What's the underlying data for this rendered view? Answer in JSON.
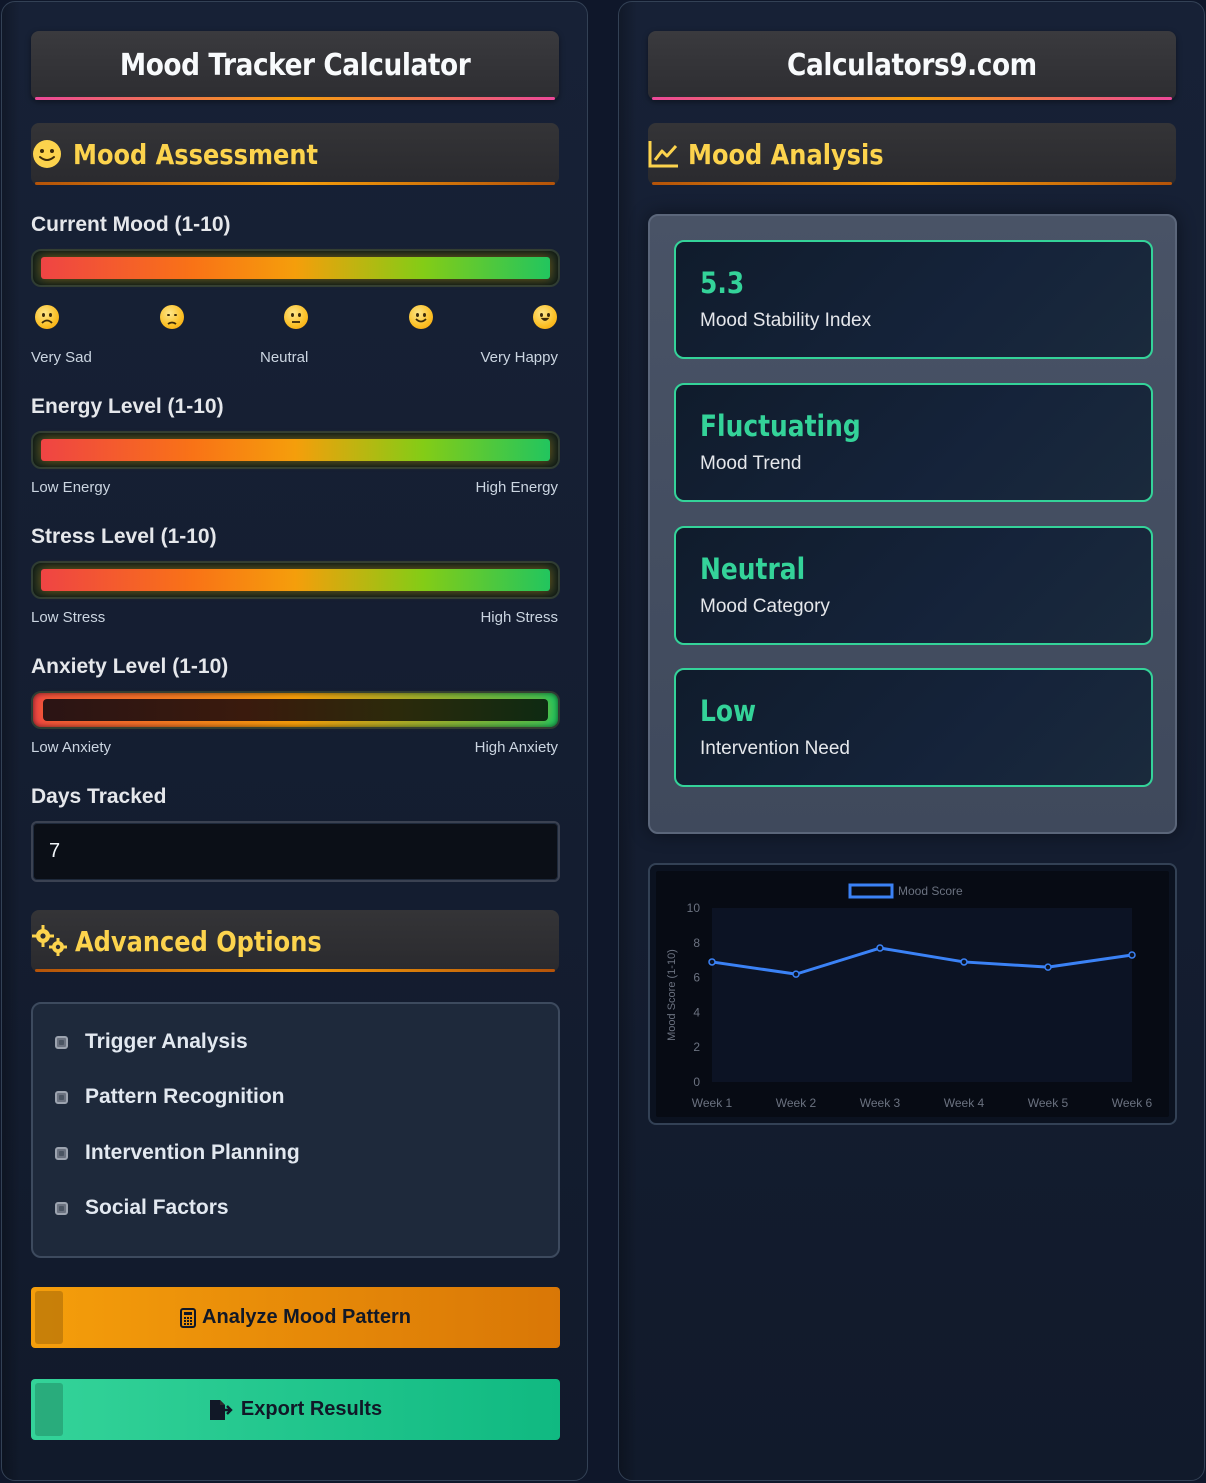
{
  "left_panel": {
    "title": "Mood Tracker Calculator",
    "section_assessment": "Mood Assessment",
    "current_mood": {
      "label": "Current Mood (1-10)",
      "min_label": "Very Sad",
      "mid_label": "Neutral",
      "max_label": "Very Happy",
      "emojis": [
        "very-sad",
        "sad",
        "neutral",
        "happy",
        "very-happy"
      ]
    },
    "energy": {
      "label": "Energy Level (1-10)",
      "min_label": "Low Energy",
      "max_label": "High Energy"
    },
    "stress": {
      "label": "Stress Level (1-10)",
      "min_label": "Low Stress",
      "max_label": "High Stress"
    },
    "anxiety": {
      "label": "Anxiety Level (1-10)",
      "min_label": "Low Anxiety",
      "max_label": "High Anxiety"
    },
    "days_tracked": {
      "label": "Days Tracked",
      "value": "7"
    },
    "section_advanced": "Advanced Options",
    "options": [
      {
        "label": "Trigger Analysis"
      },
      {
        "label": "Pattern Recognition"
      },
      {
        "label": "Intervention Planning"
      },
      {
        "label": "Social Factors"
      }
    ],
    "analyze_button": "Analyze Mood Pattern",
    "export_button": "Export Results"
  },
  "right_panel": {
    "title": "Calculators9.com",
    "section_analysis": "Mood Analysis",
    "results": [
      {
        "value": "5.3",
        "label": "Mood Stability Index"
      },
      {
        "value": "Fluctuating",
        "label": "Mood Trend"
      },
      {
        "value": "Neutral",
        "label": "Mood Category"
      },
      {
        "value": "Low",
        "label": "Intervention Need"
      }
    ]
  },
  "colors": {
    "accent_yellow": "#fcd34d",
    "result_green": "#34d399",
    "chart_line": "#3b82f6",
    "analyze_button": "#f59e0b",
    "export_button": "#10b981"
  },
  "chart_data": {
    "type": "line",
    "categories": [
      "Week 1",
      "Week 2",
      "Week 3",
      "Week 4",
      "Week 5",
      "Week 6"
    ],
    "series": [
      {
        "name": "Mood Score",
        "values": [
          6.9,
          6.2,
          7.7,
          6.9,
          6.6,
          7.3
        ]
      }
    ],
    "ylabel": "Mood Score (1-10)",
    "xlabel": "",
    "ylim": [
      0,
      10
    ],
    "yticks": [
      0,
      2,
      4,
      6,
      8,
      10
    ],
    "legend": "top-center",
    "grid": false
  }
}
